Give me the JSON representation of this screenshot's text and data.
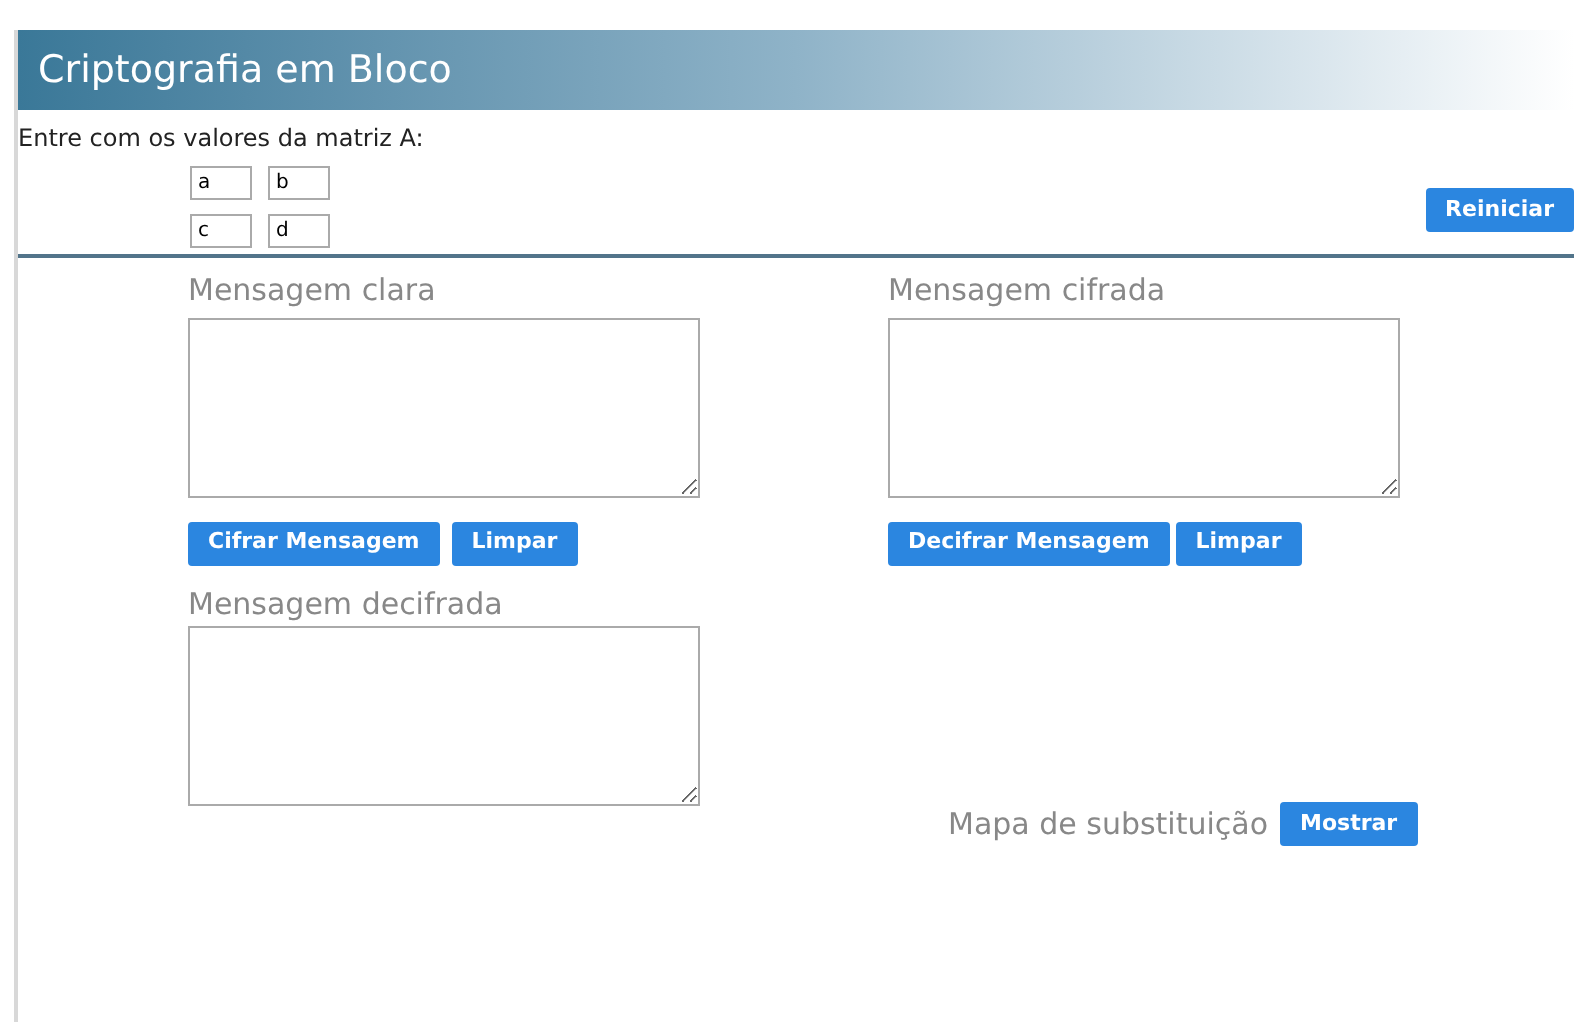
{
  "header": {
    "title": "Criptografia em Bloco"
  },
  "matrix": {
    "prompt": "Entre com os valores da matriz A:",
    "cells": [
      "a",
      "b",
      "c",
      "d"
    ]
  },
  "reset_button": "Reiniciar",
  "plain": {
    "label": "Mensagem clara",
    "buttons": [
      "Cifrar Mensagem",
      "Limpar"
    ]
  },
  "cipher": {
    "label": "Mensagem cifrada",
    "buttons": [
      "Decifrar Mensagem",
      "Limpar"
    ]
  },
  "decrypted": {
    "label": "Mensagem decifrada"
  },
  "substitution_map": {
    "label": "Mapa de substituição",
    "button": "Mostrar"
  }
}
